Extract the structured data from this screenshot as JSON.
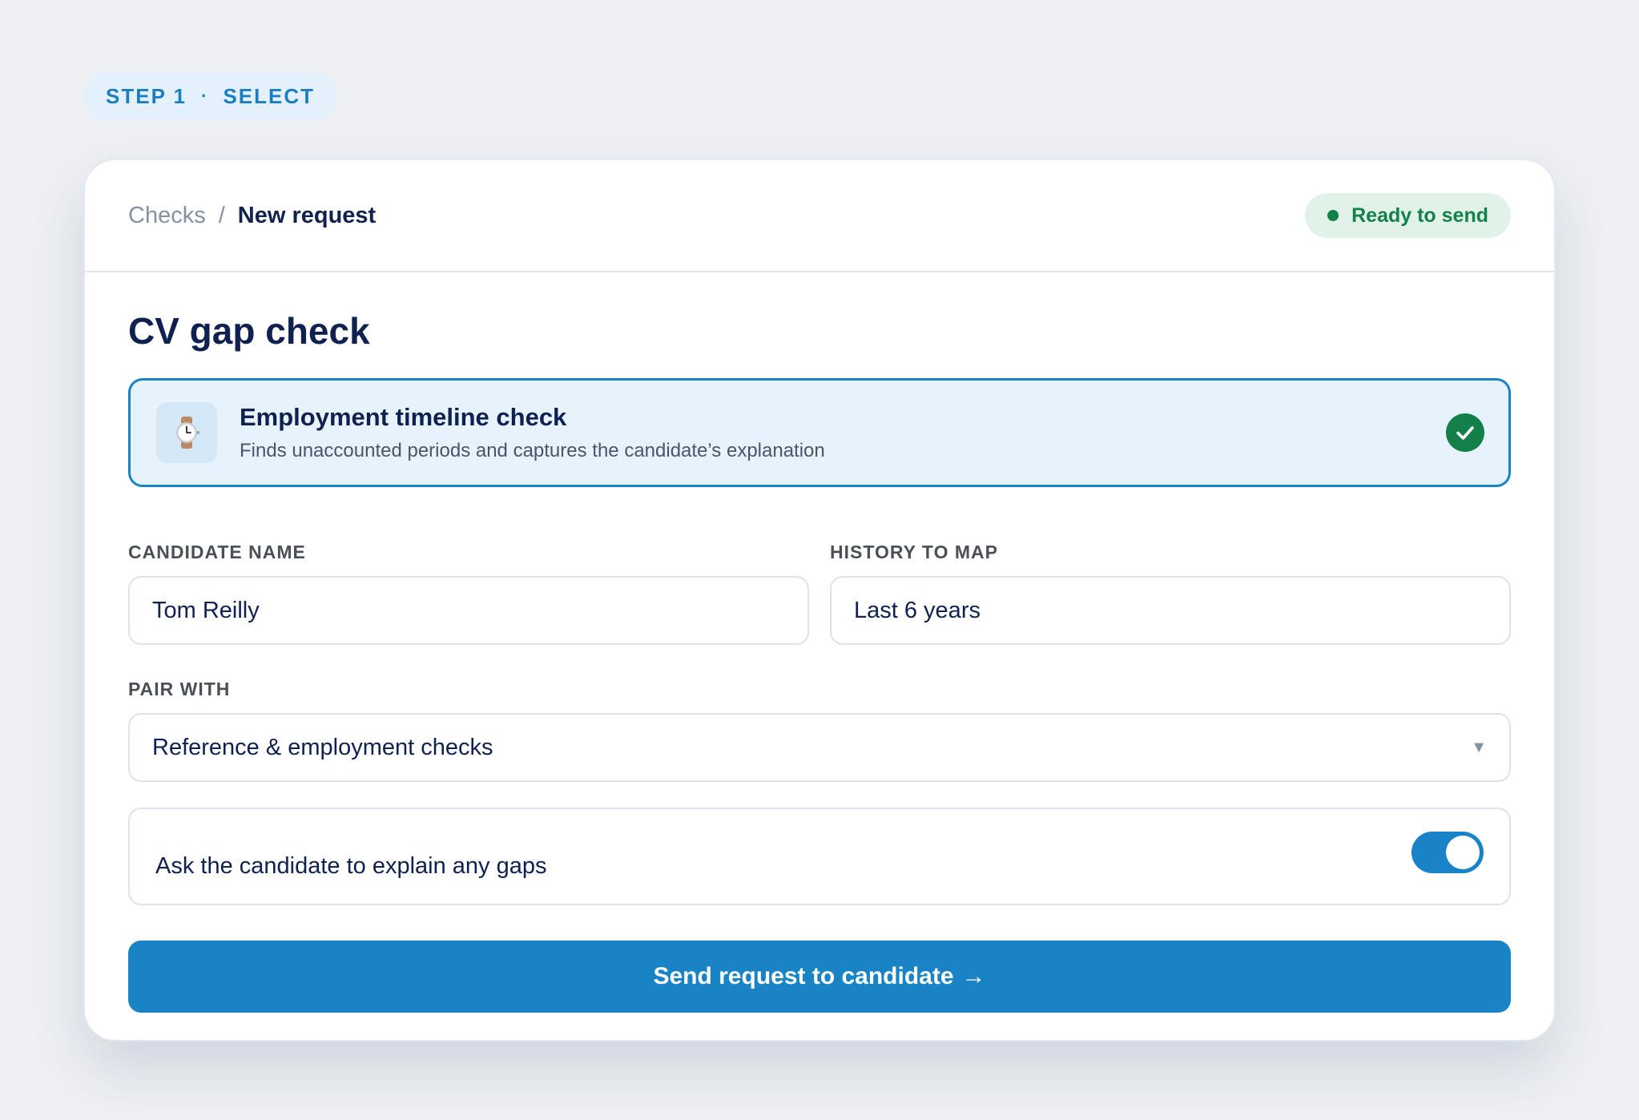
{
  "step": {
    "label": "STEP 1",
    "separator": "·",
    "name": "SELECT"
  },
  "header": {
    "breadcrumb": {
      "parent": "Checks",
      "separator": "/",
      "current": "New request"
    },
    "status": {
      "label": "Ready to send",
      "color": "#14804a"
    }
  },
  "main": {
    "title": "CV gap check",
    "selected_check": {
      "icon": "watch-icon",
      "title": "Employment timeline check",
      "description": "Finds unaccounted periods and captures the candidate’s explanation",
      "selected": true
    },
    "fields": {
      "candidate_name": {
        "label": "CANDIDATE NAME",
        "value": "Tom Reilly"
      },
      "history": {
        "label": "HISTORY TO MAP",
        "value": "Last 6 years"
      },
      "pair_with": {
        "label": "PAIR WITH",
        "value": "Reference & employment checks"
      }
    },
    "toggle": {
      "label": "Ask the candidate to explain any gaps",
      "on": true
    },
    "submit": {
      "label": "Send request to candidate",
      "arrow": "→"
    }
  },
  "colors": {
    "accent": "#1883c5",
    "success": "#128048",
    "title": "#0f2150",
    "background": "#eef0f4"
  }
}
